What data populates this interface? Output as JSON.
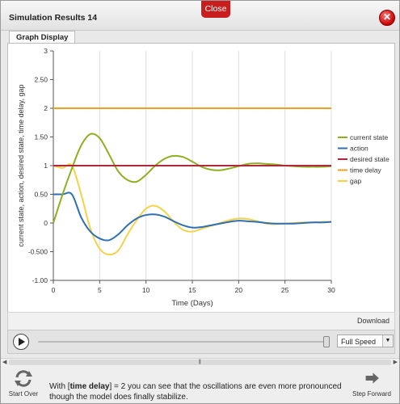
{
  "window": {
    "title": "Simulation Results 14",
    "close_tab_label": "Close",
    "close_icon": "close-x-icon"
  },
  "tabs": [
    {
      "label": "Graph Display",
      "active": true
    }
  ],
  "chart_data": {
    "type": "line",
    "title": "",
    "xlabel": "Time (Days)",
    "ylabel": "current state, action, desired state, time delay, gap",
    "xlim": [
      0,
      30
    ],
    "ylim": [
      -1.0,
      3
    ],
    "x_ticks": [
      "0",
      "5",
      "10",
      "15",
      "20",
      "25",
      "30"
    ],
    "y_ticks": [
      "-1.00",
      "-0.500",
      "0",
      "0.50",
      "1",
      "1.50",
      "2",
      "2.50",
      "3"
    ],
    "grid": "vertical",
    "legend_position": "right",
    "series": [
      {
        "name": "current state",
        "color": "#8db020",
        "x": [
          0,
          1,
          2,
          3,
          4,
          5,
          6,
          7,
          8,
          9,
          10,
          11,
          12,
          13,
          14,
          15,
          16,
          17,
          18,
          19,
          20,
          21,
          22,
          23,
          24,
          25,
          26,
          27,
          28,
          29,
          30
        ],
        "y": [
          0,
          0.5,
          0.95,
          1.35,
          1.55,
          1.48,
          1.2,
          0.9,
          0.75,
          0.72,
          0.84,
          1.0,
          1.12,
          1.17,
          1.15,
          1.07,
          0.98,
          0.93,
          0.92,
          0.95,
          0.99,
          1.03,
          1.04,
          1.03,
          1.02,
          1.0,
          0.99,
          0.98,
          0.98,
          0.98,
          0.99
        ]
      },
      {
        "name": "action",
        "color": "#2f6fb3",
        "x": [
          0,
          1,
          2,
          3,
          4,
          5,
          6,
          7,
          8,
          9,
          10,
          11,
          12,
          13,
          14,
          15,
          16,
          17,
          18,
          19,
          20,
          21,
          22,
          23,
          24,
          25,
          26,
          27,
          28,
          29,
          30
        ],
        "y": [
          0.5,
          0.5,
          0.5,
          0.1,
          -0.15,
          -0.27,
          -0.3,
          -0.2,
          -0.04,
          0.08,
          0.14,
          0.15,
          0.11,
          0.03,
          -0.04,
          -0.08,
          -0.07,
          -0.04,
          -0.01,
          0.02,
          0.04,
          0.03,
          0.02,
          0.0,
          -0.01,
          -0.01,
          -0.01,
          0.0,
          0.01,
          0.01,
          0.02
        ]
      },
      {
        "name": "desired state",
        "color": "#b3273a",
        "x": [
          0,
          30
        ],
        "y": [
          1,
          1
        ]
      },
      {
        "name": "time delay",
        "color": "#f0a020",
        "x": [
          0,
          30
        ],
        "y": [
          2,
          2
        ]
      },
      {
        "name": "gap",
        "color": "#f5d24a",
        "x": [
          0,
          1,
          2,
          3,
          4,
          5,
          6,
          7,
          8,
          9,
          10,
          11,
          12,
          13,
          14,
          15,
          16,
          17,
          18,
          19,
          20,
          21,
          22,
          23,
          24,
          25,
          26,
          27,
          28,
          29,
          30
        ],
        "y": [
          1.0,
          0.96,
          1.0,
          0.5,
          -0.1,
          -0.45,
          -0.55,
          -0.48,
          -0.2,
          0.05,
          0.25,
          0.3,
          0.2,
          0.02,
          -0.12,
          -0.15,
          -0.1,
          -0.05,
          0.0,
          0.05,
          0.08,
          0.07,
          0.03,
          -0.01,
          -0.02,
          -0.01,
          0.0,
          0.01,
          0.01,
          0.02,
          0.02
        ]
      }
    ]
  },
  "download_label": "Download",
  "controls": {
    "play_icon": "play-icon",
    "speed_value": "Full Speed",
    "speed_position": 1.0
  },
  "footer": {
    "start_over_label": "Start Over",
    "step_forward_label": "Step Forward",
    "message_prefix": "With [",
    "message_param": "time delay",
    "message_suffix": "] = 2 you can see that the oscillations are even more pronounced though the model does finally stabilize."
  }
}
